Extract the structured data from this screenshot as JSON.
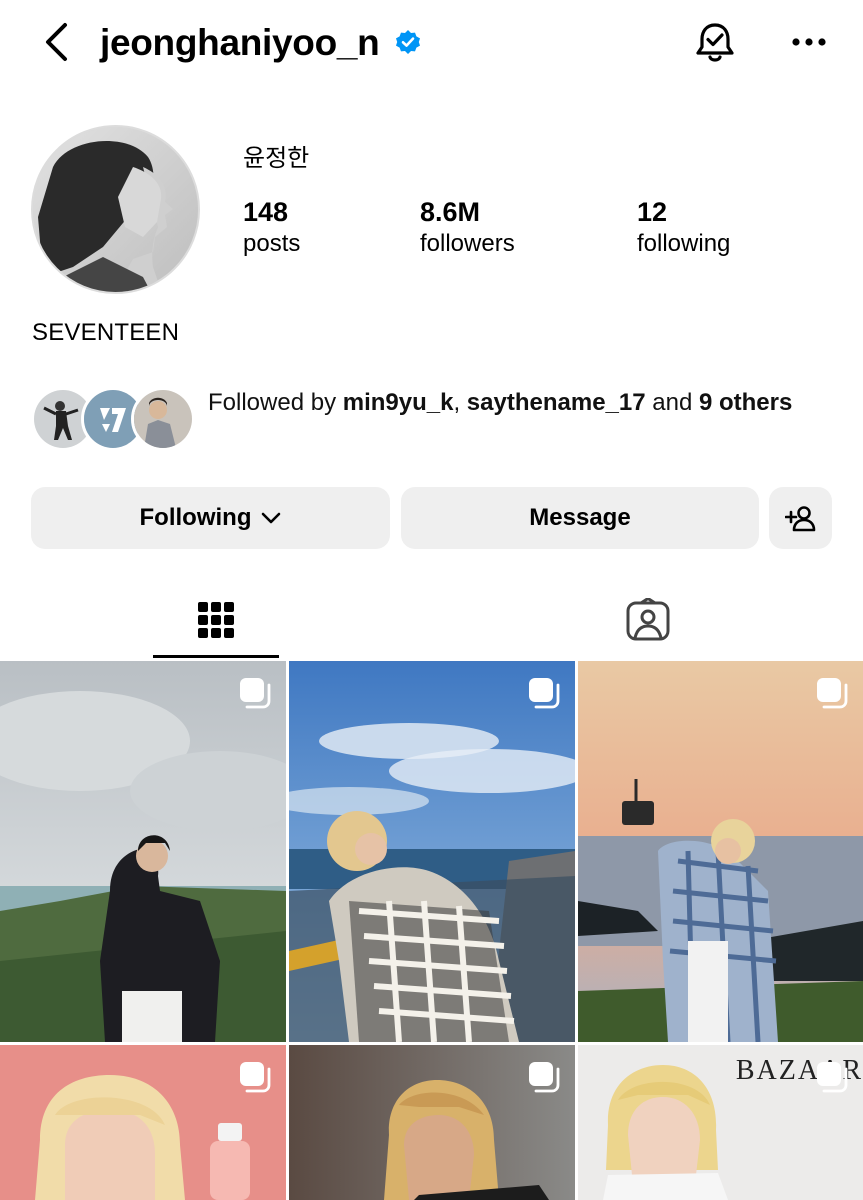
{
  "header": {
    "username": "jeonghaniyoo_n",
    "icons": {
      "back": "chevron-left-icon",
      "verified": "verified-badge-icon",
      "notifications": "bell-check-icon",
      "more": "more-horizontal-icon"
    }
  },
  "profile": {
    "display_name": "윤정한",
    "stats": {
      "posts": {
        "value": "148",
        "label": "posts"
      },
      "followers": {
        "value": "8.6M",
        "label": "followers"
      },
      "following": {
        "value": "12",
        "label": "following"
      }
    },
    "bio": "SEVENTEEN"
  },
  "followed_by": {
    "prefix": "Followed by ",
    "user1": "min9yu_k",
    "sep": ", ",
    "user2": "saythename_17",
    "and": " and ",
    "others": "9 others"
  },
  "actions": {
    "following_label": "Following",
    "message_label": "Message",
    "icons": {
      "dropdown": "chevron-down-icon",
      "add_user": "add-user-icon"
    }
  },
  "tabs": {
    "items": [
      {
        "name": "posts-grid",
        "icon": "grid-icon",
        "active": true
      },
      {
        "name": "tagged",
        "icon": "tagged-person-icon",
        "active": false
      }
    ]
  },
  "posts": {
    "brand_text": "BAZAAR",
    "items": [
      {
        "kind": "photo",
        "scene": "coast-cloudy",
        "multi": true
      },
      {
        "kind": "photo",
        "scene": "blue-sky-boardwalk",
        "multi": true
      },
      {
        "kind": "photo",
        "scene": "sunset-camera",
        "multi": true
      },
      {
        "kind": "photo",
        "scene": "pink-portrait",
        "multi": true
      },
      {
        "kind": "photo",
        "scene": "dark-portrait",
        "multi": true
      },
      {
        "kind": "photo",
        "scene": "magazine-portrait",
        "multi": true
      }
    ]
  },
  "colors": {
    "verified": "#0095f6",
    "button_bg": "#efefef",
    "text": "#000000"
  }
}
